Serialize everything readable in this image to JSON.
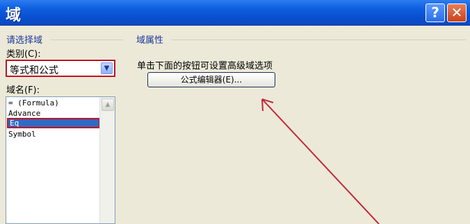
{
  "window": {
    "title": "域",
    "help_glyph": "?",
    "close_glyph": "✕"
  },
  "left": {
    "section_title": "请选择域",
    "category_label": "类别(C):",
    "category_value": "等式和公式",
    "field_names_label": "域名(F):",
    "field_names": [
      "= (Formula)",
      "Advance",
      "Eq",
      "Symbol"
    ],
    "selected_index": 2
  },
  "right": {
    "section_title": "域属性",
    "instruction": "单击下面的按钮可设置高级域选项",
    "button_label": "公式编辑器(E)..."
  },
  "colors": {
    "highlight": "#c01420",
    "annotation_arrow": "#c0283c",
    "selection": "#316ac5"
  }
}
